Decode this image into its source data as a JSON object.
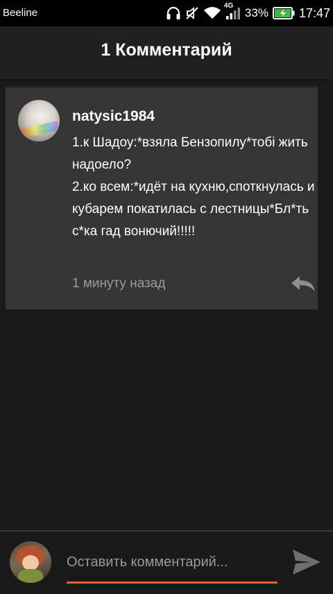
{
  "status_bar": {
    "carrier": "Beeline",
    "network": "4G",
    "battery": "33%",
    "time": "17:47",
    "icons": [
      "headset-icon",
      "mute-icon",
      "wifi-icon",
      "signal-icon",
      "battery-charging-icon"
    ]
  },
  "header": {
    "title": "1 Комментарий"
  },
  "comments": [
    {
      "author": "natysic1984",
      "text": "1.к Шадоу:*взяла Бензопилу*тобі жить надоело?\n2.ко всем:*идёт на кухню,споткнулась и кубарем покатилась с лестницы*Бл*ть с*ка гад вонючий!!!!!",
      "time": "1 минуту назад",
      "avatar": "user-avatar-cat",
      "reply_icon": "reply-icon"
    }
  ],
  "composer": {
    "placeholder": "Оставить комментарий...",
    "value": "",
    "send_icon": "send-icon",
    "accent": "#e8603b"
  },
  "colors": {
    "background": "#1b1a1b",
    "card": "#363536",
    "header": "#222022",
    "muted_text": "#9d9c9d"
  }
}
